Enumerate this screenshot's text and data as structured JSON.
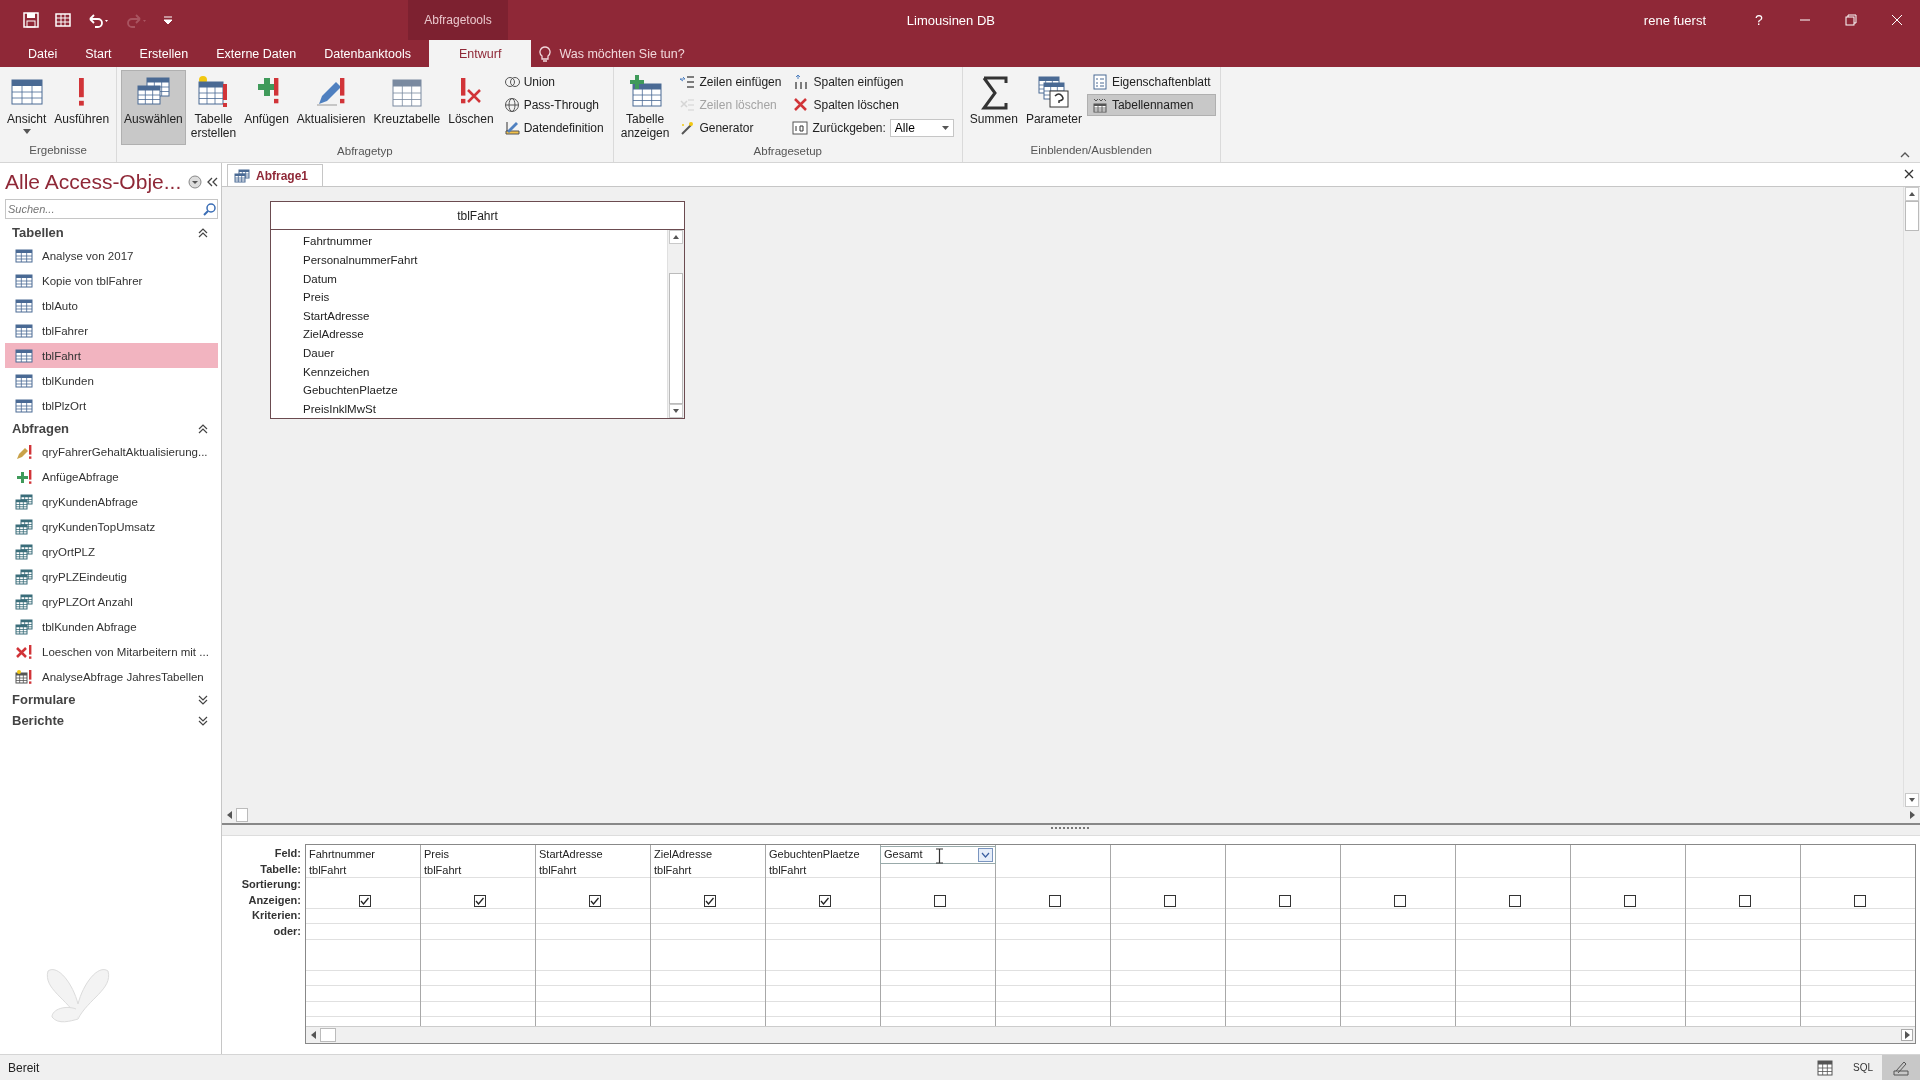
{
  "window": {
    "title": "Limousinen DB",
    "context_tab": "Abfragetools",
    "user": "rene fuerst",
    "help": "?"
  },
  "quick_access": [
    {
      "kind": "save",
      "disabled": false
    },
    {
      "kind": "table",
      "disabled": false
    },
    {
      "kind": "undo",
      "disabled": false
    },
    {
      "kind": "redo",
      "disabled": true
    },
    {
      "kind": "customize",
      "disabled": false
    }
  ],
  "tabs": [
    {
      "label": "Datei",
      "selected": false
    },
    {
      "label": "Start",
      "selected": false
    },
    {
      "label": "Erstellen",
      "selected": false
    },
    {
      "label": "Externe Daten",
      "selected": false
    },
    {
      "label": "Datenbanktools",
      "selected": false
    },
    {
      "label": "Entwurf",
      "selected": true
    }
  ],
  "tell_me": {
    "placeholder": "Was möchten Sie tun?"
  },
  "ribbon": [
    {
      "name": "Ergebnisse",
      "buttons": [
        {
          "label": "Ansicht",
          "kind": "large",
          "dropdown": true,
          "selected": false,
          "disabled": false
        },
        {
          "label": "Ausführen",
          "kind": "large",
          "dropdown": false,
          "selected": false,
          "disabled": false
        }
      ]
    },
    {
      "name": "Abfragetyp",
      "buttons": [
        {
          "label": "Auswählen",
          "kind": "large",
          "dropdown": false,
          "selected": true,
          "disabled": false
        },
        {
          "label": "Tabelle erstellen",
          "kind": "large",
          "dropdown": false,
          "selected": false,
          "disabled": false
        },
        {
          "label": "Anfügen",
          "kind": "large",
          "dropdown": false,
          "selected": false,
          "disabled": false
        },
        {
          "label": "Aktualisieren",
          "kind": "large",
          "dropdown": false,
          "selected": false,
          "disabled": false
        },
        {
          "label": "Kreuztabelle",
          "kind": "large",
          "dropdown": false,
          "selected": false,
          "disabled": false
        },
        {
          "label": "Löschen",
          "kind": "large",
          "dropdown": false,
          "selected": false,
          "disabled": false
        },
        {
          "label": "Union",
          "kind": "small",
          "selected": false,
          "disabled": false
        },
        {
          "label": "Pass-Through",
          "kind": "small",
          "selected": false,
          "disabled": false
        },
        {
          "label": "Datendefinition",
          "kind": "small",
          "selected": false,
          "disabled": false
        }
      ]
    },
    {
      "name": "Abfragesetup",
      "buttons": [
        {
          "label": "Tabelle anzeigen",
          "kind": "large",
          "dropdown": false,
          "selected": false,
          "disabled": false
        },
        {
          "label": "Zeilen einfügen",
          "kind": "small",
          "selected": false,
          "disabled": false
        },
        {
          "label": "Zeilen löschen",
          "kind": "small",
          "selected": false,
          "disabled": true
        },
        {
          "label": "Generator",
          "kind": "small",
          "selected": false,
          "disabled": false
        },
        {
          "label": "Spalten einfügen",
          "kind": "small",
          "selected": false,
          "disabled": false
        },
        {
          "label": "Spalten löschen",
          "kind": "small",
          "selected": false,
          "disabled": false
        },
        {
          "label": "Zurückgeben:",
          "kind": "select",
          "value": "Alle"
        }
      ]
    },
    {
      "name": "Einblenden/Ausblenden",
      "buttons": [
        {
          "label": "Summen",
          "kind": "large",
          "dropdown": false,
          "selected": false,
          "disabled": false
        },
        {
          "label": "Parameter",
          "kind": "large",
          "dropdown": false,
          "selected": false,
          "disabled": false
        },
        {
          "label": "Eigenschaftenblatt",
          "kind": "small",
          "selected": false,
          "disabled": false
        },
        {
          "label": "Tabellennamen",
          "kind": "small",
          "selected": true,
          "disabled": false
        }
      ]
    }
  ],
  "navigation": {
    "title": "Alle Access-Obje...",
    "search": {
      "placeholder": "Suchen..."
    },
    "groups": [
      {
        "label": "Tabellen",
        "expanded": true,
        "items": [
          {
            "label": "Analyse von 2017",
            "kind": "table",
            "selected": false
          },
          {
            "label": "Kopie von tblFahrer",
            "kind": "table",
            "selected": false
          },
          {
            "label": "tblAuto",
            "kind": "table",
            "selected": false
          },
          {
            "label": "tblFahrer",
            "kind": "table",
            "selected": false
          },
          {
            "label": "tblFahrt",
            "kind": "table",
            "selected": true
          },
          {
            "label": "tblKunden",
            "kind": "table",
            "selected": false
          },
          {
            "label": "tblPlzOrt",
            "kind": "table",
            "selected": false
          }
        ]
      },
      {
        "label": "Abfragen",
        "expanded": true,
        "items": [
          {
            "label": "qryFahrerGehaltAktualisierung...",
            "kind": "update",
            "selected": false
          },
          {
            "label": "AnfügeAbfrage",
            "kind": "append",
            "selected": false
          },
          {
            "label": "qryKundenAbfrage",
            "kind": "select",
            "selected": false
          },
          {
            "label": "qryKundenTopUmsatz",
            "kind": "select",
            "selected": false
          },
          {
            "label": "qryOrtPLZ",
            "kind": "select",
            "selected": false
          },
          {
            "label": "qryPLZEindeutig",
            "kind": "select",
            "selected": false
          },
          {
            "label": "qryPLZOrt Anzahl",
            "kind": "select",
            "selected": false
          },
          {
            "label": "tblKunden Abfrage",
            "kind": "select",
            "selected": false
          },
          {
            "label": "Loeschen von Mitarbeitern mit ...",
            "kind": "delete",
            "selected": false
          },
          {
            "label": "AnalyseAbfrage JahresTabellen",
            "kind": "maketable",
            "selected": false
          }
        ]
      },
      {
        "label": "Formulare",
        "expanded": false
      },
      {
        "label": "Berichte",
        "expanded": false
      }
    ]
  },
  "document_tabs": [
    {
      "label": "Abfrage1",
      "selected": true
    }
  ],
  "table_box": {
    "title": "tblFahrt",
    "fields": [
      "Fahrtnummer",
      "PersonalnummerFahrt",
      "Datum",
      "Preis",
      "StartAdresse",
      "ZielAdresse",
      "Dauer",
      "Kennzeichen",
      "GebuchtenPlaetze",
      "PreisInklMwSt"
    ]
  },
  "design_grid": {
    "row_labels": [
      "Feld:",
      "Tabelle:",
      "Sortierung:",
      "Anzeigen:",
      "Kriterien:",
      "oder:"
    ],
    "columns": [
      {
        "field": "Fahrtnummer",
        "table": "tblFahrt",
        "show": true,
        "editing": false
      },
      {
        "field": "Preis",
        "table": "tblFahrt",
        "show": true,
        "editing": false
      },
      {
        "field": "StartAdresse",
        "table": "tblFahrt",
        "show": true,
        "editing": false
      },
      {
        "field": "ZielAdresse",
        "table": "tblFahrt",
        "show": true,
        "editing": false
      },
      {
        "field": "GebuchtenPlaetze",
        "table": "tblFahrt",
        "show": true,
        "editing": false
      },
      {
        "field": "Gesamt",
        "show": false,
        "editing": true
      },
      {
        "show": false,
        "editing": false
      },
      {
        "show": false,
        "editing": false
      },
      {
        "show": false,
        "editing": false
      },
      {
        "show": false,
        "editing": false
      },
      {
        "show": false,
        "editing": false
      },
      {
        "show": false,
        "editing": false
      },
      {
        "show": false,
        "editing": false
      },
      {
        "show": false,
        "editing": false
      }
    ]
  },
  "status_bar": {
    "text": "Bereit",
    "views": [
      {
        "kind": "datasheet",
        "selected": false
      },
      {
        "kind": "sql",
        "label": "SQL",
        "selected": false
      },
      {
        "kind": "design",
        "selected": true
      }
    ]
  }
}
